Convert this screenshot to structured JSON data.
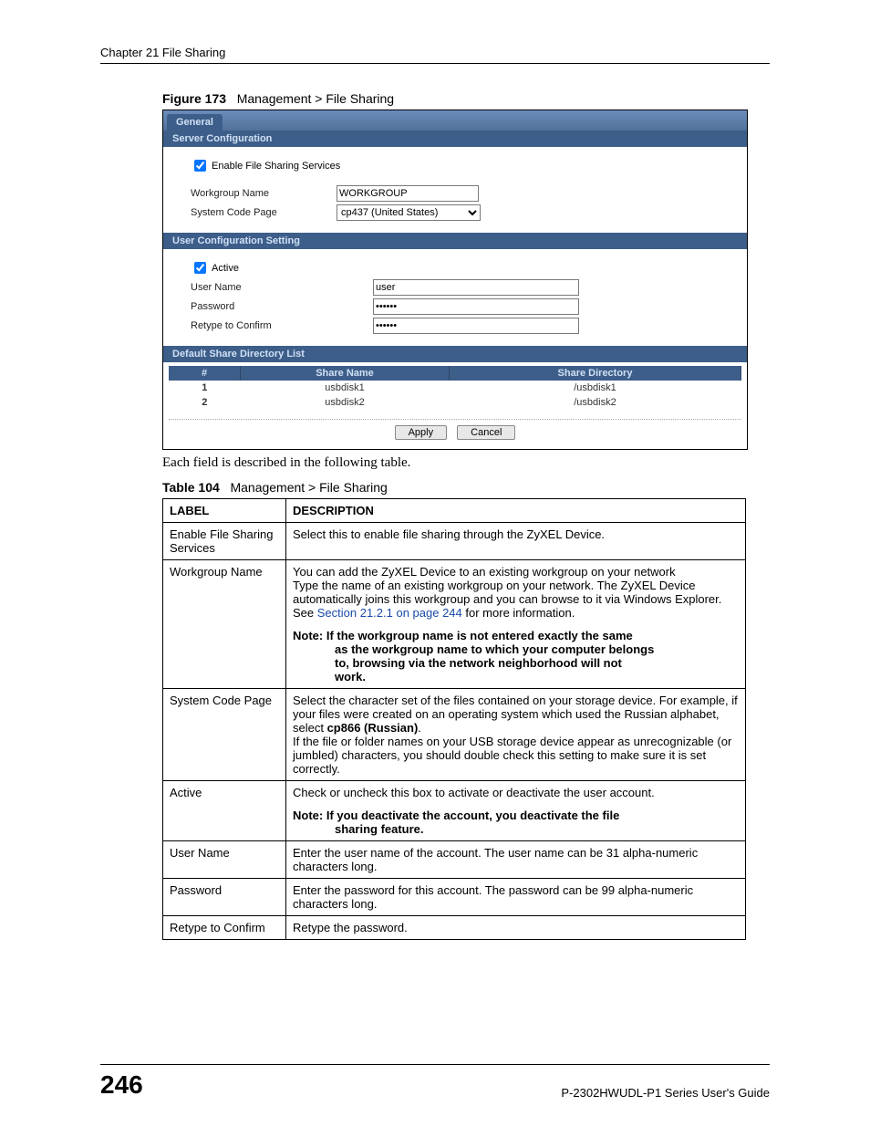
{
  "runningHead": "Chapter 21 File Sharing",
  "figure": {
    "label": "Figure 173",
    "title": "Management > File Sharing"
  },
  "shot": {
    "tab": "General",
    "sections": {
      "server": {
        "title": "Server Configuration",
        "enableLabel": "Enable File Sharing Services",
        "workgroupLabel": "Workgroup Name",
        "workgroupValue": "WORKGROUP",
        "codepageLabel": "System Code Page",
        "codepageValue": "cp437 (United States)"
      },
      "user": {
        "title": "User Configuration Setting",
        "activeLabel": "Active",
        "usernameLabel": "User Name",
        "usernameValue": "user",
        "passwordLabel": "Password",
        "passwordValue": "••••••",
        "retypeLabel": "Retype to Confirm",
        "retypeValue": "••••••"
      },
      "dirs": {
        "title": "Default Share Directory List",
        "headers": {
          "num": "#",
          "name": "Share Name",
          "dir": "Share Directory"
        },
        "rows": [
          {
            "num": "1",
            "name": "usbdisk1",
            "dir": "/usbdisk1"
          },
          {
            "num": "2",
            "name": "usbdisk2",
            "dir": "/usbdisk2"
          }
        ]
      }
    },
    "buttons": {
      "apply": "Apply",
      "cancel": "Cancel"
    }
  },
  "intro": "Each field is described in the following table.",
  "table": {
    "label": "Table 104",
    "title": "Management > File Sharing"
  },
  "columns": {
    "label": "LABEL",
    "desc": "DESCRIPTION"
  },
  "rows": {
    "enable": {
      "label": "Enable File Sharing Services",
      "desc": "Select this to enable file sharing through the ZyXEL Device."
    },
    "workgroup": {
      "label": "Workgroup Name",
      "p1": "You can add the ZyXEL Device to an existing workgroup on your network",
      "p2a": "Type the name of an existing workgroup on your network. The ZyXEL Device automatically joins this workgroup and you can browse to it via Windows Explorer. See ",
      "p2link": "Section 21.2.1 on page 244",
      "p2b": " for more information.",
      "note1": "Note: If the workgroup name is not entered exactly the same",
      "note2": "as the workgroup name to which your computer belongs",
      "note3": "to, browsing via the network neighborhood will not",
      "note4": "work."
    },
    "codepage": {
      "label": "System Code Page",
      "p1a": "Select the character set of the files contained on your storage device. For example, if your files were created on an operating system which used the Russian alphabet, select ",
      "p1bold": "cp866 (Russian)",
      "p1b": ".",
      "p2": "If the file or folder names on your USB storage device appear as unrecognizable (or jumbled) characters, you should double check this setting to make sure it is set correctly."
    },
    "active": {
      "label": "Active",
      "p1": "Check or uncheck this box to activate or deactivate the user account.",
      "note1": "Note: If you deactivate the account, you deactivate the file",
      "note2": "sharing feature."
    },
    "username": {
      "label": "User Name",
      "desc": "Enter the user name of the account. The user name can be 31 alpha-numeric characters long."
    },
    "password": {
      "label": "Password",
      "desc": "Enter the password for this account. The password can be 99 alpha-numeric characters long."
    },
    "retype": {
      "label": "Retype to Confirm",
      "desc": "Retype the password."
    }
  },
  "footer": {
    "page": "246",
    "doc": "P-2302HWUDL-P1 Series User's Guide"
  }
}
